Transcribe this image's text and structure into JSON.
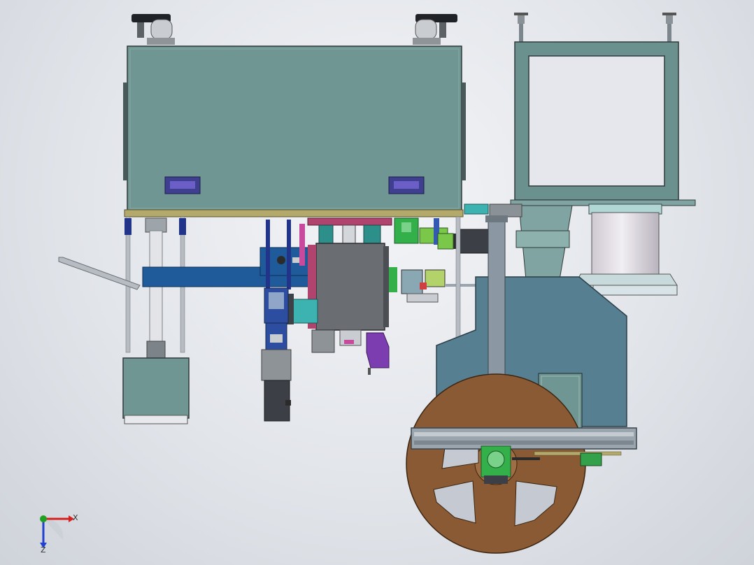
{
  "viewport": {
    "background_top": "#f3f4f7",
    "background_bottom": "#cfd3da"
  },
  "colors": {
    "housing_teal": "#6f9692",
    "frame_teal": "#6b918f",
    "mount_blue": "#567f92",
    "arm_blue": "#1f5b9a",
    "reel_brown": "#8a5a34",
    "motor_dark": "#3c3f45",
    "panel_gray": "#6a6d71",
    "window_purple": "#5b4fb0",
    "cylinder_light": "#e4e1e6",
    "green_part": "#33b04a",
    "purple_part": "#7c3db0",
    "magenta_part": "#b0446e",
    "rail_gray": "#9ba5ad",
    "feet_black": "#1f2226"
  },
  "triad": {
    "x_label": "X",
    "z_label": "Z",
    "x_color": "#d62020",
    "y_color": "#20a020",
    "z_color": "#2040d0"
  }
}
